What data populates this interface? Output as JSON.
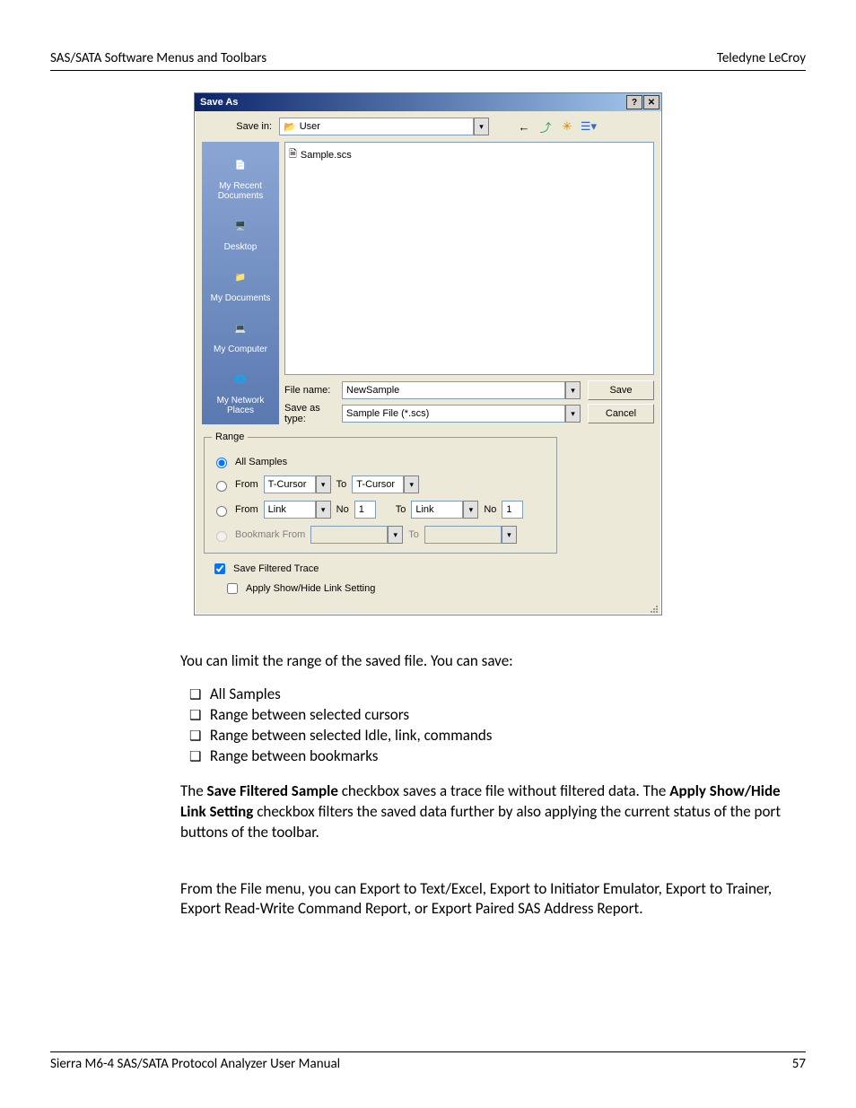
{
  "header": {
    "left": "SAS/SATA Software Menus and Toolbars",
    "right": "Teledyne LeCroy"
  },
  "footer": {
    "left": "Sierra M6-4 SAS/SATA Protocol Analyzer User Manual",
    "right": "57"
  },
  "dialog": {
    "title": "Save As",
    "save_in_label": "Save in:",
    "save_in_value": "User",
    "places": {
      "recent": "My Recent Documents",
      "desktop": "Desktop",
      "mydocs": "My Documents",
      "mycomp": "My Computer",
      "mynet": "My Network Places"
    },
    "file_in_list": "Sample.scs",
    "fn_label": "File name:",
    "fn_value": "NewSample",
    "type_label": "Save as type:",
    "type_value": "Sample File (*.scs)",
    "save_btn": "Save",
    "cancel_btn": "Cancel",
    "range": {
      "legend": "Range",
      "all_samples": "All Samples",
      "from": "From",
      "to": "To",
      "no": "No",
      "tcursor": "T-Cursor",
      "link": "Link",
      "one": "1",
      "bookmark": "Bookmark  From"
    },
    "save_filtered": "Save Filtered Trace",
    "apply_showhide": "Apply Show/Hide Link Setting"
  },
  "body": {
    "intro": "You can limit the range of the saved file. You can save:",
    "bullets": [
      "All Samples",
      "Range between selected cursors",
      "Range between selected Idle, link, commands",
      "Range between bookmarks"
    ],
    "p2_a": "The ",
    "p2_b": "Save Filtered Sample",
    "p2_c": " checkbox saves a trace file without filtered data. The ",
    "p2_d": "Apply Show/Hide Link Setting",
    "p2_e": " checkbox filters the saved data further by also applying the current status of the port buttons of the toolbar.",
    "p3": "From the File menu, you can Export to Text/Excel, Export to Initiator Emulator, Export to Trainer, Export Read-Write Command Report, or Export Paired SAS Address Report."
  }
}
